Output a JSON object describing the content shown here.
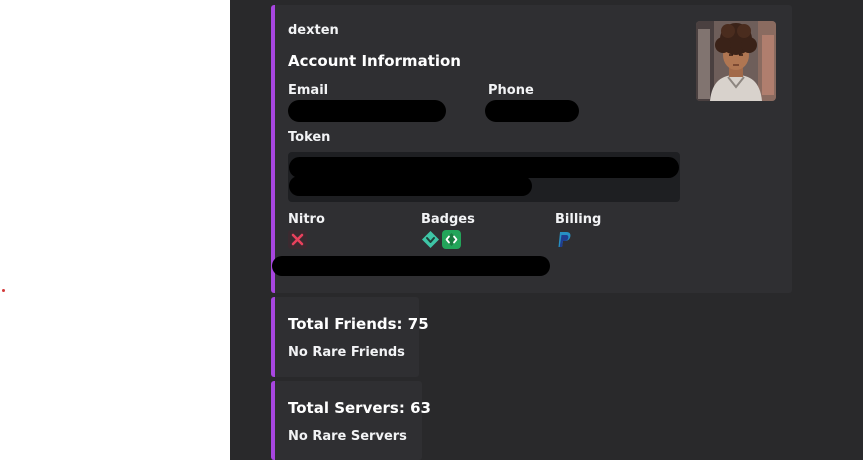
{
  "embed": {
    "author": "dexten",
    "title": "Account Information",
    "fields": {
      "email_label": "Email",
      "phone_label": "Phone",
      "token_label": "Token",
      "nitro_label": "Nitro",
      "badges_label": "Badges",
      "billing_label": "Billing"
    },
    "icons": {
      "nitro": "x-mark-icon",
      "badges": [
        "hypesquad-icon",
        "active-developer-icon"
      ],
      "billing": "paypal-icon"
    },
    "accent_color": "#a846e0"
  },
  "friends": {
    "title": "Total Friends: 75",
    "subtitle": "No Rare Friends"
  },
  "servers": {
    "title": "Total Servers: 63",
    "subtitle": "No Rare Servers"
  }
}
